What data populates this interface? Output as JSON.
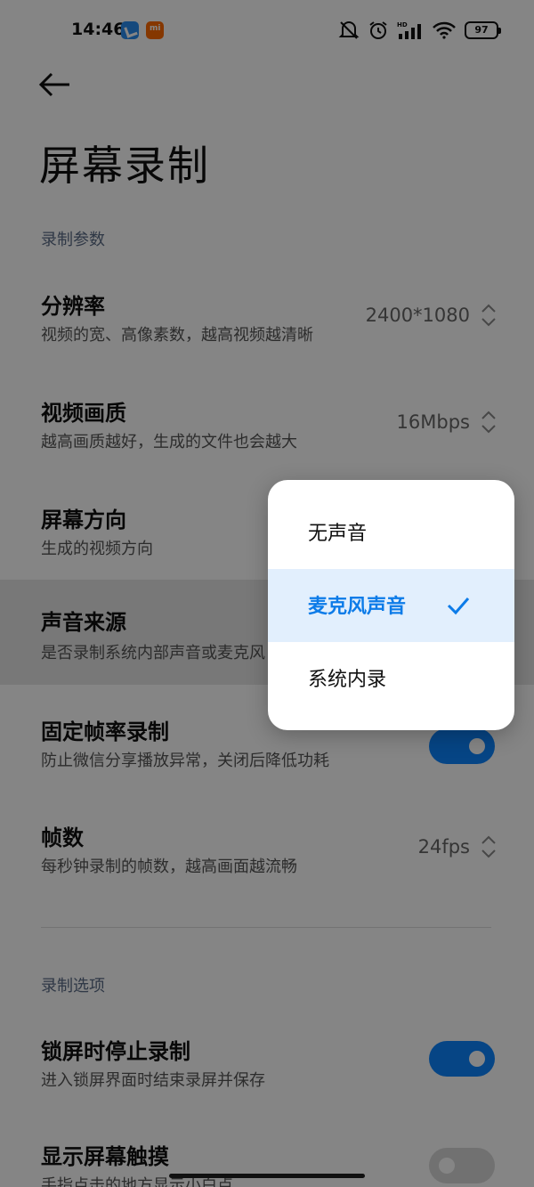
{
  "status_bar": {
    "time": "14:46",
    "battery": "97",
    "network_label": "HD"
  },
  "page": {
    "title": "屏幕录制"
  },
  "sections": {
    "params_label": "录制参数",
    "options_label": "录制选项"
  },
  "rows": [
    {
      "title": "分辨率",
      "subtitle": "视频的宽、高像素数，越高视频越清晰",
      "value": "2400*1080"
    },
    {
      "title": "视频画质",
      "subtitle": "越高画质越好，生成的文件也会越大",
      "value": "16Mbps"
    },
    {
      "title": "屏幕方向",
      "subtitle": "生成的视频方向"
    },
    {
      "title": "声音来源",
      "subtitle": "是否录制系统内部声音或麦克风"
    },
    {
      "title": "固定帧率录制",
      "subtitle": "防止微信分享播放异常，关闭后降低功耗",
      "toggle": true
    },
    {
      "title": "帧数",
      "subtitle": "每秒钟录制的帧数，越高画面越流畅",
      "value": "24fps"
    },
    {
      "title": "锁屏时停止录制",
      "subtitle": "进入锁屏界面时结束录屏并保存",
      "toggle": true
    },
    {
      "title": "显示屏幕触摸",
      "subtitle": "手指点击的地方显示小白点",
      "toggle": false
    }
  ],
  "popup": {
    "options": [
      {
        "label": "无声音",
        "selected": false
      },
      {
        "label": "麦克风声音",
        "selected": true
      },
      {
        "label": "系统内录",
        "selected": false
      }
    ]
  },
  "colors": {
    "accent": "#0d84ff",
    "selected_text": "#0c7be8",
    "selected_bg": "#e2effd",
    "section_label": "#5b6b86"
  },
  "icons": [
    "back-arrow-icon",
    "chevron-updown-icon",
    "checkmark-icon",
    "mute-icon",
    "alarm-icon",
    "signal-icon",
    "wifi-icon",
    "battery-icon"
  ]
}
